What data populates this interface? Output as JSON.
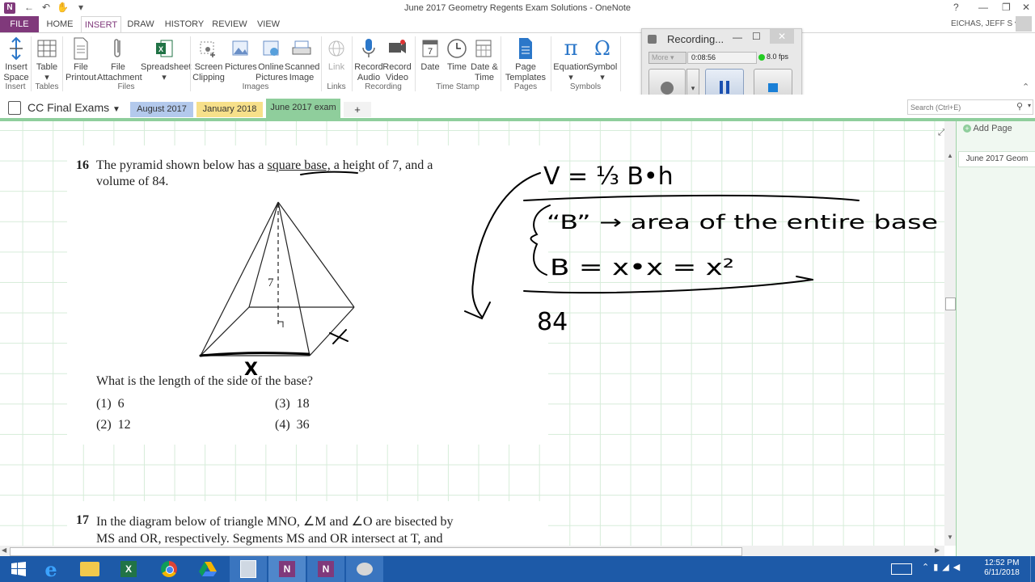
{
  "window": {
    "title": "June 2017 Geometry Regents Exam Solutions - OneNote",
    "help": "?",
    "user": "EICHAS, JEFF S",
    "minimize": "—",
    "restore": "❐",
    "close": "✕"
  },
  "quick_access": {
    "back": "←",
    "undo": "↶",
    "touch": "✋",
    "customize": "▾"
  },
  "ribbon_tabs": [
    "FILE",
    "HOME",
    "INSERT",
    "DRAW",
    "HISTORY",
    "REVIEW",
    "VIEW"
  ],
  "ribbon": {
    "buttons": [
      {
        "label": "Insert\nSpace"
      },
      {
        "label": "Table"
      },
      {
        "label": "File\nPrintout"
      },
      {
        "label": "File\nAttachment"
      },
      {
        "label": "Spreadsheet"
      },
      {
        "label": "Screen\nClipping"
      },
      {
        "label": "Pictures"
      },
      {
        "label": "Online\nPictures"
      },
      {
        "label": "Scanned\nImage"
      },
      {
        "label": "Link"
      },
      {
        "label": "Record\nAudio"
      },
      {
        "label": "Record\nVideo"
      },
      {
        "label": "Date"
      },
      {
        "label": "Time"
      },
      {
        "label": "Date &\nTime"
      },
      {
        "label": "Page\nTemplates"
      },
      {
        "label": "Equation"
      },
      {
        "label": "Symbol"
      }
    ],
    "groups": [
      "Insert",
      "Tables",
      "Files",
      "Images",
      "Links",
      "Recording",
      "Time Stamp",
      "Pages",
      "Symbols"
    ],
    "date_icon_day": "7",
    "equation_glyph": "π",
    "symbol_glyph": "Ω"
  },
  "recorder": {
    "title": "Recording...",
    "mode": "More",
    "elapsed": "0:08:56",
    "fps": "8.0 fps",
    "colors": {
      "status": "#22cc22",
      "stop": "#1a7fd6",
      "pause": "#1a4fb0"
    }
  },
  "notebook": {
    "name": "CC Final Exams",
    "sections": [
      {
        "label": "August 2017",
        "color": "#b3c9ec"
      },
      {
        "label": "January 2018",
        "color": "#f7e08a"
      },
      {
        "label": "June 2017 exam",
        "color": "#8fce9c"
      }
    ],
    "add_section": "+"
  },
  "search": {
    "placeholder": "Search (Ctrl+E)"
  },
  "page_pane": {
    "add_page": "Add Page",
    "pages": [
      "June 2017 Geom"
    ]
  },
  "question16": {
    "number": "16",
    "text_line1_a": "The pyramid shown below has a ",
    "text_line1_u": "square base,",
    "text_line1_b": " a height of 7, and a",
    "text_line2": "volume of 84.",
    "height_label": "7",
    "prompt": "What is the length of the side of the base?",
    "choices": [
      {
        "num": "(1)",
        "value": "6"
      },
      {
        "num": "(3)",
        "value": "18"
      },
      {
        "num": "(2)",
        "value": "12"
      },
      {
        "num": "(4)",
        "value": "36"
      }
    ]
  },
  "question17": {
    "number": "17",
    "line1": "In the diagram below of triangle MNO, ∠M and ∠O are bisected by",
    "line2": "MS and OR, respectively. Segments MS and OR intersect at T, and"
  },
  "ink": {
    "formula": "V = ⅓ B•h",
    "base_note": "“B” → area of the entire base",
    "base_formula": "B = x•x = x²",
    "volume": "84",
    "side_x": "x",
    "base_x": "X",
    "color": "#000000"
  },
  "taskbar": {
    "time": "12:52 PM",
    "date": "6/11/2018",
    "accent": "#1d5aa8"
  }
}
